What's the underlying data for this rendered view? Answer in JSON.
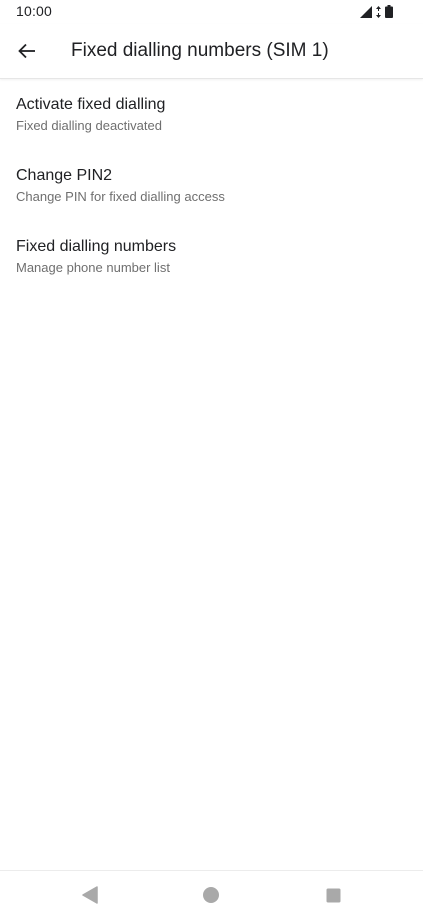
{
  "status_bar": {
    "time": "10:00",
    "icons": [
      "signal-icon",
      "data-arrows-icon",
      "battery-icon"
    ]
  },
  "app_bar": {
    "back_icon": "arrow-back-icon",
    "title": "Fixed dialling numbers (SIM 1)"
  },
  "settings": {
    "items": [
      {
        "title": "Activate fixed dialling",
        "summary": "Fixed dialling deactivated"
      },
      {
        "title": "Change PIN2",
        "summary": "Change PIN for fixed dialling access"
      },
      {
        "title": "Fixed dialling numbers",
        "summary": "Manage phone number list"
      }
    ]
  },
  "nav_bar": {
    "buttons": [
      "back-triangle-icon",
      "home-circle-icon",
      "recents-square-icon"
    ]
  },
  "colors": {
    "text_primary": "#202124",
    "text_secondary": "#6f6f6f",
    "nav_icon": "#a9a9a9",
    "background": "#ffffff"
  }
}
